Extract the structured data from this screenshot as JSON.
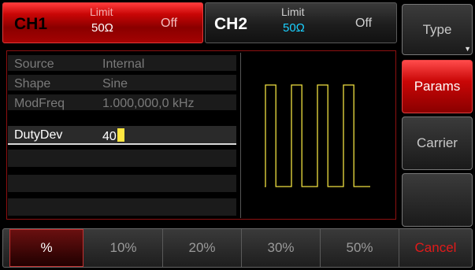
{
  "channels": [
    {
      "name": "CH1",
      "limit_label": "Limit",
      "impedance": "50Ω",
      "output_state": "Off"
    },
    {
      "name": "CH2",
      "limit_label": "Limit",
      "impedance": "50Ω",
      "output_state": "Off"
    }
  ],
  "params": [
    {
      "label": "Source",
      "value": "Internal"
    },
    {
      "label": "Shape",
      "value": "Sine"
    },
    {
      "label": "ModFreq",
      "value": "1.000,000,0 kHz"
    },
    {
      "label": "DutyDev",
      "value": "40"
    }
  ],
  "side_menu": {
    "type": "Type",
    "params": "Params",
    "carrier": "Carrier",
    "blank": ""
  },
  "bottom_keys": [
    "%",
    "10%",
    "20%",
    "30%",
    "50%",
    "Cancel"
  ],
  "colors": {
    "accent": "#c90606",
    "waveform": "#f0e040",
    "ch2_impedance": "#1ad0ff",
    "cursor": "#ffe640",
    "cancel": "#e11a1a"
  },
  "waveform": {
    "type": "pulse train",
    "cycles": 4,
    "duty_cycle_percent": 40
  }
}
